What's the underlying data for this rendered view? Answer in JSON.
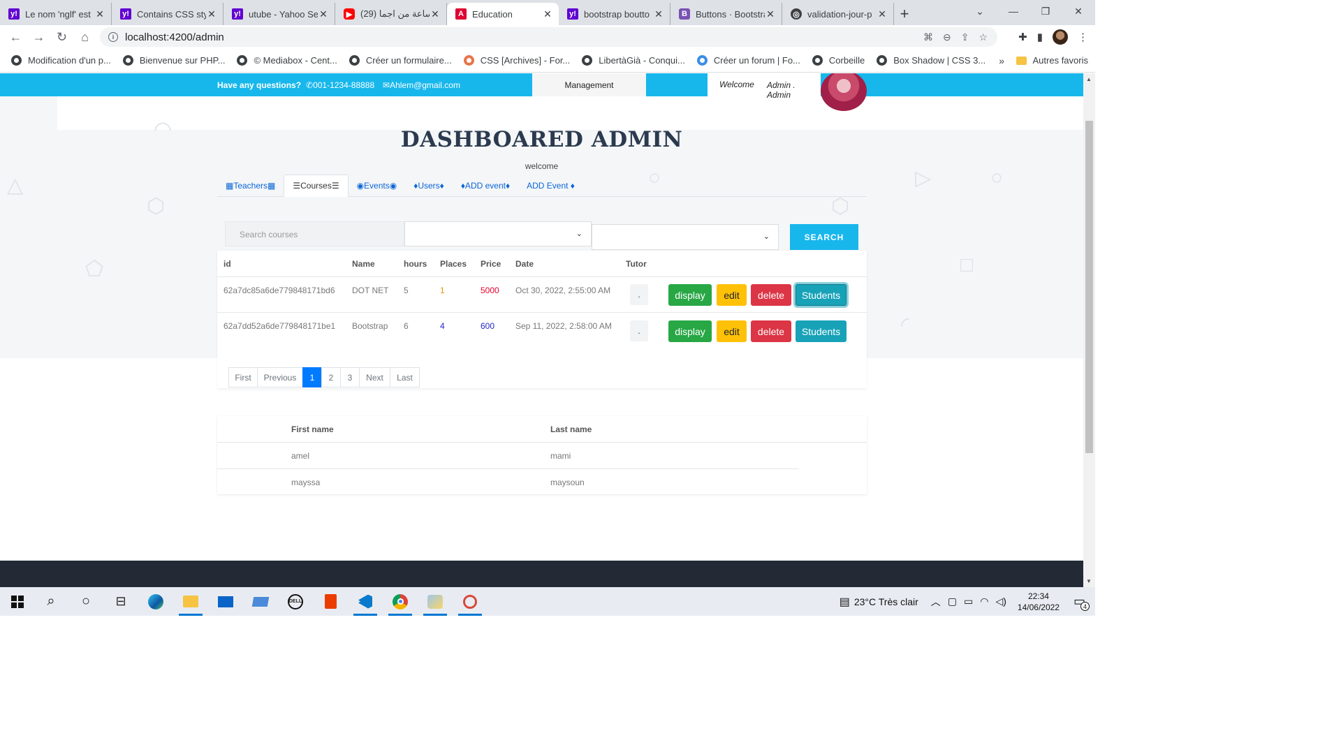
{
  "browser": {
    "tabs": [
      {
        "title": "Le nom 'nglf' est",
        "favicon": "yahoo",
        "active": false
      },
      {
        "title": "Contains CSS styl",
        "favicon": "yahoo",
        "active": false
      },
      {
        "title": "utube - Yahoo Se",
        "favicon": "yahoo",
        "active": false
      },
      {
        "title": "(29) ساعة من اجما",
        "favicon": "youtube",
        "active": false
      },
      {
        "title": "Education",
        "favicon": "angular",
        "active": true
      },
      {
        "title": "bootstrap boutto",
        "favicon": "yahoo",
        "active": false
      },
      {
        "title": "Buttons · Bootstra",
        "favicon": "bootstrap",
        "active": false
      },
      {
        "title": "validation-jour-p",
        "favicon": "globe",
        "active": false
      }
    ],
    "url": "localhost:4200/admin",
    "bookmarks": [
      "Modification d'un p...",
      "Bienvenue sur PHP...",
      "© Mediabox - Cent...",
      "Créer un formulaire...",
      "CSS [Archives] - For...",
      "LibertàGià - Conqui...",
      "Créer un forum | Fo...",
      "Corbeille",
      "Box Shadow | CSS 3..."
    ],
    "bookmarks_more": "»",
    "other_bookmarks": "Autres favoris"
  },
  "site": {
    "topbar": {
      "question": "Have any questions?",
      "phone": "001-1234-88888",
      "email": "Ahlem@gmail.com",
      "management": "Management",
      "welcome": "Welcome",
      "user": "Admin . Admin"
    },
    "title": "DASHBOARED ADMIN",
    "subtitle": "welcome",
    "tabs": [
      {
        "label": "▦Teachers▦",
        "active": false
      },
      {
        "label": "☰Courses☰",
        "active": true
      },
      {
        "label": "◉Events◉",
        "active": false
      },
      {
        "label": "♦Users♦",
        "active": false
      },
      {
        "label": "♦ADD event♦",
        "active": false
      },
      {
        "label": "ADD Event ♦",
        "active": false
      }
    ],
    "search": {
      "placeholder": "Search courses",
      "button": "SEARCH"
    },
    "courses_table": {
      "headers": [
        "id",
        "Name",
        "hours",
        "Places",
        "Price",
        "Date",
        "Tutor"
      ],
      "rows": [
        {
          "id": "62a7dc85a6de779848171bd6",
          "name": "DOT NET",
          "hours": "5",
          "places": "1",
          "price": "5000",
          "date": "Oct 30, 2022, 2:55:00 AM",
          "tutor": "."
        },
        {
          "id": "62a7dd52a6de779848171be1",
          "name": "Bootstrap",
          "hours": "6",
          "places": "4",
          "price": "600",
          "date": "Sep 11, 2022, 2:58:00 AM",
          "tutor": "."
        }
      ],
      "actions": {
        "display": "display",
        "edit": "edit",
        "delete": "delete",
        "students": "Students"
      }
    },
    "pagination": [
      "First",
      "Previous",
      "1",
      "2",
      "3",
      "Next",
      "Last"
    ],
    "students_table": {
      "headers": [
        "First name",
        "Last name"
      ],
      "rows": [
        {
          "first": "amel",
          "last": "mami"
        },
        {
          "first": "mayssa",
          "last": "maysoun"
        }
      ]
    }
  },
  "taskbar": {
    "weather": "23°C  Très clair",
    "time": "22:34",
    "date": "14/06/2022",
    "notifications": "4"
  },
  "colors": {
    "accent": "#17b7ec",
    "display": "#28a745",
    "edit": "#ffc107",
    "delete": "#dc3545",
    "students": "#17a2b8",
    "places_first": "#e69500",
    "price_first": "#e5002b",
    "places_second": "#2424c8",
    "price_second": "#2424c8"
  }
}
